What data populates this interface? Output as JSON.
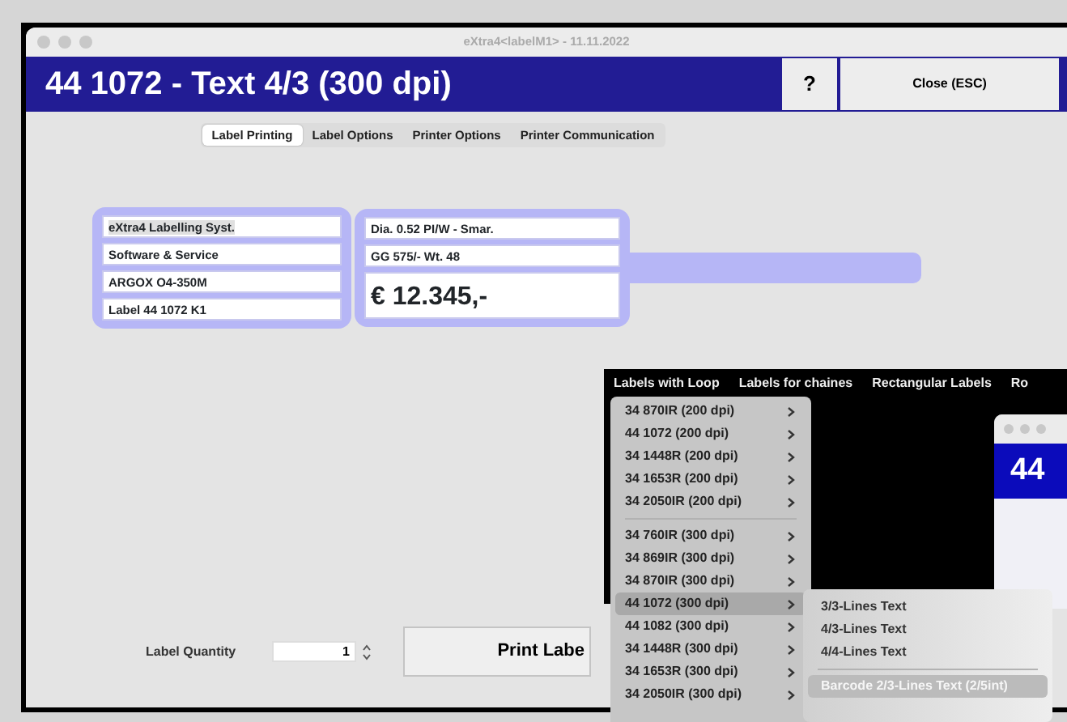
{
  "window": {
    "title": "eXtra4<labelM1>  -  11.11.2022",
    "header_title": "44 1072 - Text 4/3 (300 dpi)",
    "help_button": "?",
    "close_button": "Close (ESC)"
  },
  "tabs": [
    {
      "label": "Label Printing",
      "selected": true
    },
    {
      "label": "Label Options",
      "selected": false
    },
    {
      "label": "Printer Options",
      "selected": false
    },
    {
      "label": "Printer Communication",
      "selected": false
    }
  ],
  "label_preview": {
    "left_lines": [
      {
        "text": "eXtra4 Labelling Syst.",
        "selected": true
      },
      {
        "text": "Software & Service",
        "selected": false
      },
      {
        "text": "ARGOX O4-350M",
        "selected": false
      },
      {
        "text": "Label 44 1072 K1",
        "selected": false
      }
    ],
    "right_lines": [
      "Dia. 0.52 PI/W - Smar.",
      "GG 575/-  Wt. 48"
    ],
    "price": "€ 12.345,-"
  },
  "quantity": {
    "label": "Label Quantity",
    "value": "1"
  },
  "print_button": "Print Labe",
  "menu_bar": [
    "Labels with Loop",
    "Labels for chaines",
    "Rectangular Labels",
    "Ro"
  ],
  "menu_groups": [
    [
      {
        "label": "34 870IR (200 dpi)",
        "selected": false
      },
      {
        "label": "44 1072 (200 dpi)",
        "selected": false
      },
      {
        "label": "34 1448R (200 dpi)",
        "selected": false
      },
      {
        "label": "34 1653R (200 dpi)",
        "selected": false
      },
      {
        "label": "34 2050IR (200 dpi)",
        "selected": false
      }
    ],
    [
      {
        "label": "34 760IR (300 dpi)",
        "selected": false
      },
      {
        "label": "34 869IR (300 dpi)",
        "selected": false
      },
      {
        "label": "34 870IR (300 dpi)",
        "selected": false
      },
      {
        "label": "44 1072 (300 dpi)",
        "selected": true
      },
      {
        "label": "44 1082 (300 dpi)",
        "selected": false
      },
      {
        "label": "34 1448R (300 dpi)",
        "selected": false
      },
      {
        "label": "34 1653R (300 dpi)",
        "selected": false
      },
      {
        "label": "34 2050IR (300 dpi)",
        "selected": false
      }
    ]
  ],
  "submenu_groups": [
    [
      {
        "label": "3/3-Lines Text",
        "selected": false
      },
      {
        "label": "4/3-Lines Text",
        "selected": false
      },
      {
        "label": "4/4-Lines Text",
        "selected": false
      }
    ],
    [
      {
        "label": "Barcode 2/3-Lines Text (2/5int)",
        "selected": true
      }
    ]
  ],
  "back_window": {
    "header_title": "44"
  }
}
